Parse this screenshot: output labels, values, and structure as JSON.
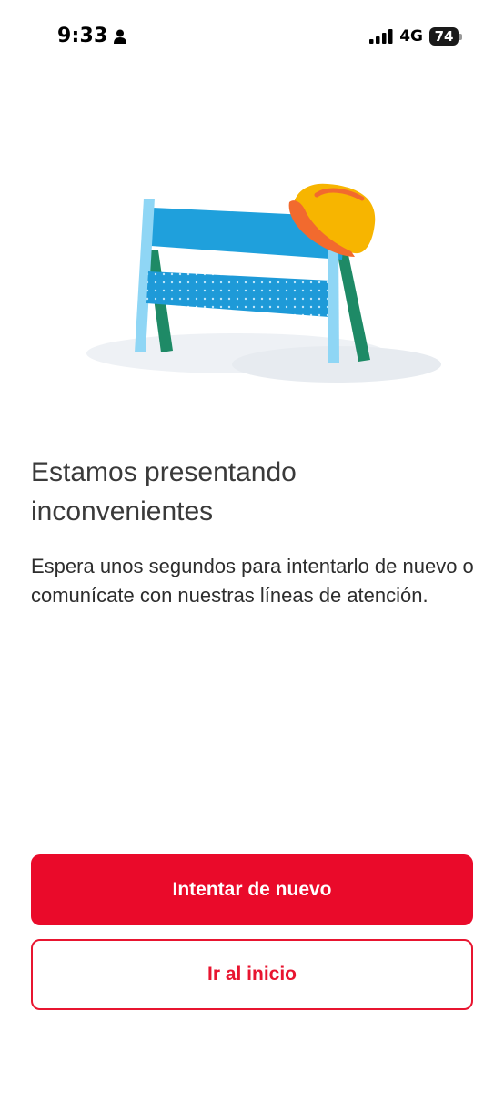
{
  "status_bar": {
    "time": "9:33",
    "network": "4G",
    "battery": "74",
    "icons": [
      "person-icon",
      "signal-bars-icon",
      "battery-icon"
    ]
  },
  "illustration": {
    "icon": "construction-barrier-with-hard-hat-icon"
  },
  "content": {
    "title_line1": "Estamos presentando",
    "title_line2": "inconvenientes",
    "description": "Espera unos segundos para intentarlo de nuevo o comunícate con nuestras líneas de atención."
  },
  "actions": {
    "retry_label": "Intentar de nuevo",
    "home_label": "Ir al inicio"
  },
  "colors": {
    "primary": "#ea0a2a",
    "barrier_blue": "#1fa0dc",
    "helmet_yellow": "#f7b500",
    "helmet_orange": "#f26a2e",
    "leg_green": "#1e8a66"
  }
}
